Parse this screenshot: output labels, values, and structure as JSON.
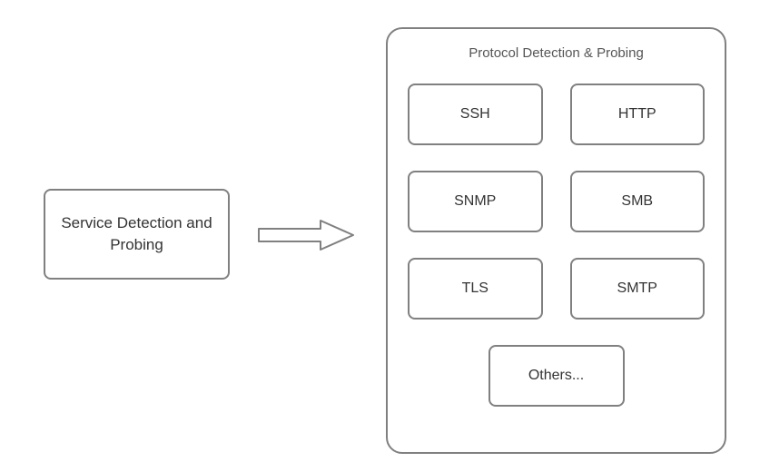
{
  "left_box": {
    "label": "Service Detection and Probing"
  },
  "right_container": {
    "title": "Protocol Detection & Probing",
    "protocols": [
      {
        "label": "SSH"
      },
      {
        "label": "HTTP"
      },
      {
        "label": "SNMP"
      },
      {
        "label": "SMB"
      },
      {
        "label": "TLS"
      },
      {
        "label": "SMTP"
      }
    ],
    "others": {
      "label": "Others..."
    }
  }
}
